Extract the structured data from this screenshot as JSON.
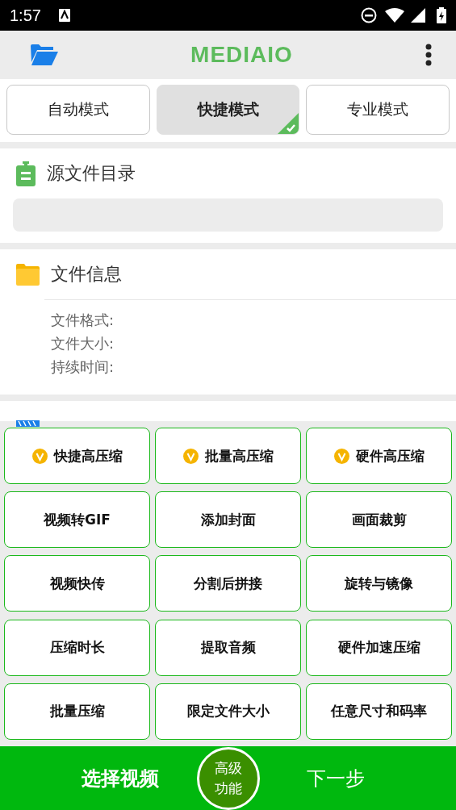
{
  "status_bar": {
    "time": "1:57"
  },
  "toolbar": {
    "title": "MEDIAIO"
  },
  "mode_tabs": [
    {
      "label": "自动模式",
      "selected": false
    },
    {
      "label": "快捷模式",
      "selected": true
    },
    {
      "label": "专业模式",
      "selected": false
    }
  ],
  "source_section": {
    "title": "源文件目录"
  },
  "file_info": {
    "title": "文件信息",
    "fields": [
      "文件格式:",
      "文件大小:",
      "持续时间:"
    ]
  },
  "functions": [
    {
      "label": "快捷高压缩",
      "vip": true
    },
    {
      "label": "批量高压缩",
      "vip": true
    },
    {
      "label": "硬件高压缩",
      "vip": true
    },
    {
      "label": "视频转GIF",
      "vip": false
    },
    {
      "label": "添加封面",
      "vip": false
    },
    {
      "label": "画面裁剪",
      "vip": false
    },
    {
      "label": "视频快传",
      "vip": false
    },
    {
      "label": "分割后拼接",
      "vip": false
    },
    {
      "label": "旋转与镜像",
      "vip": false
    },
    {
      "label": "压缩时长",
      "vip": false
    },
    {
      "label": "提取音频",
      "vip": false
    },
    {
      "label": "硬件加速压缩",
      "vip": false
    },
    {
      "label": "批量压缩",
      "vip": false
    },
    {
      "label": "限定文件大小",
      "vip": false
    },
    {
      "label": "任意尺寸和码率",
      "vip": false
    }
  ],
  "bottom_bar": {
    "select": "选择视频",
    "advanced": [
      "高级",
      "功能"
    ],
    "next": "下一步"
  }
}
